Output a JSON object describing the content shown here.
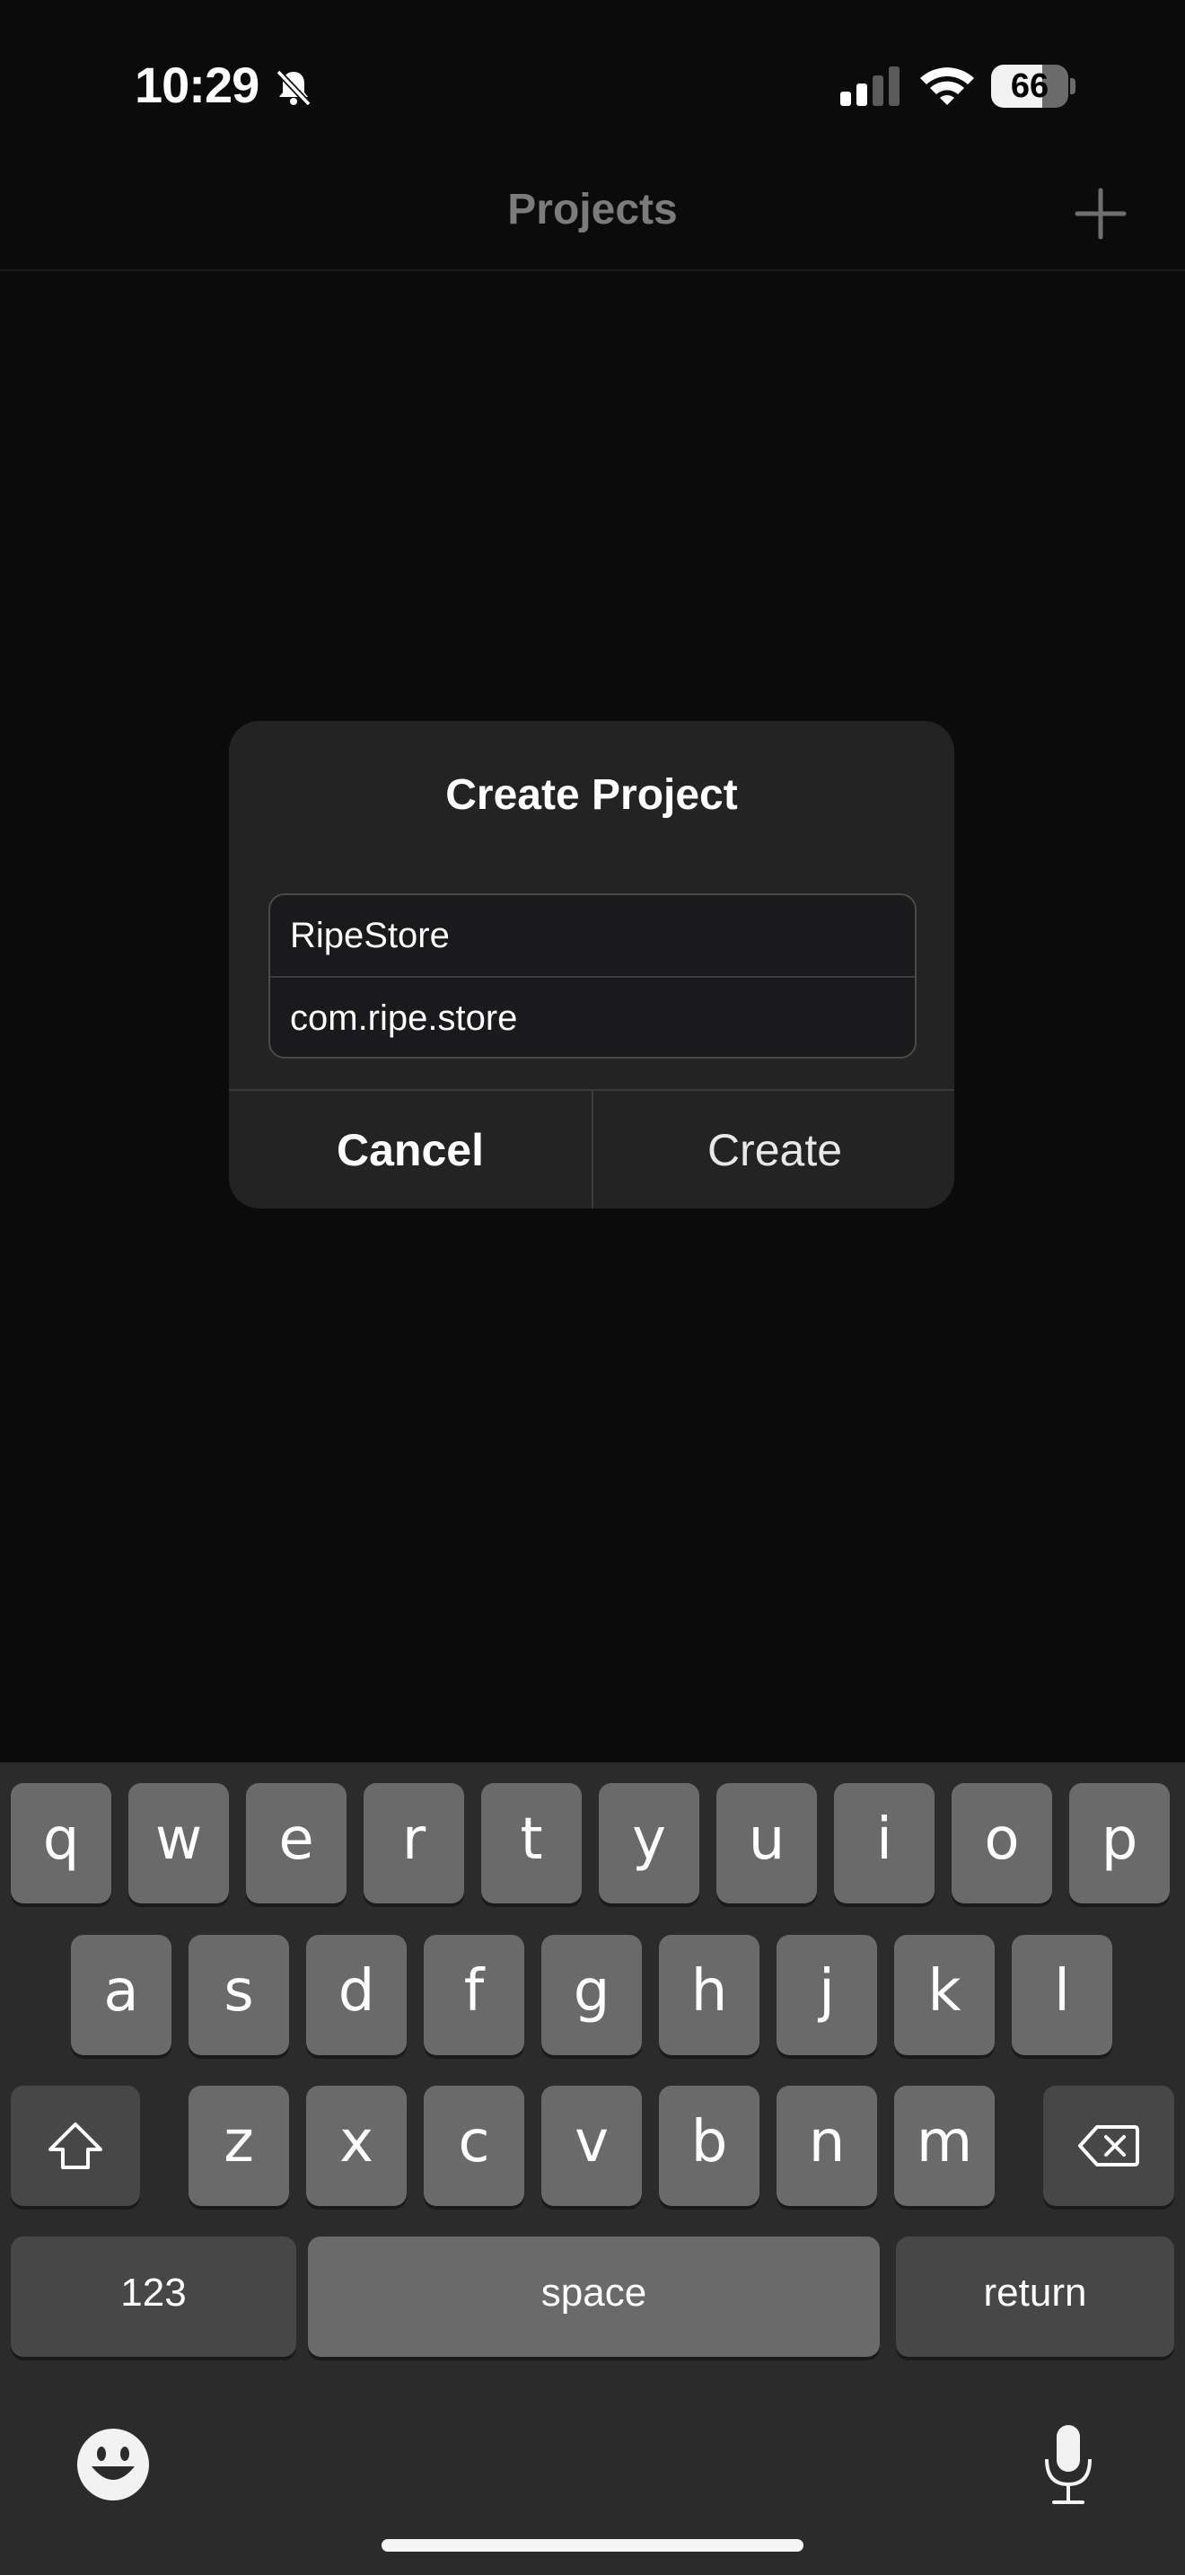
{
  "status": {
    "time": "10:29",
    "battery": "66",
    "battery_level_percent": 66,
    "icons": [
      "bell-slash-icon",
      "cellular-signal-icon",
      "wifi-icon",
      "battery-icon"
    ]
  },
  "nav": {
    "title": "Projects",
    "add_icon": "plus-icon"
  },
  "dialog": {
    "title": "Create Project",
    "name_value": "RipeStore",
    "bundle_value": "com.ripe.store",
    "cancel_label": "Cancel",
    "create_label": "Create"
  },
  "keyboard": {
    "row1": [
      "q",
      "w",
      "e",
      "r",
      "t",
      "y",
      "u",
      "i",
      "o",
      "p"
    ],
    "row2": [
      "a",
      "s",
      "d",
      "f",
      "g",
      "h",
      "j",
      "k",
      "l"
    ],
    "row3": [
      "z",
      "x",
      "c",
      "v",
      "b",
      "n",
      "m"
    ],
    "numbers_label": "123",
    "space_label": "space",
    "return_label": "return",
    "icons": [
      "shift-icon",
      "delete-icon",
      "emoji-icon",
      "microphone-icon"
    ]
  },
  "colors": {
    "background": "#0b0b0b",
    "dialog": "#232323",
    "key": "#6a6a6a",
    "key_dark": "#474747",
    "keyboard": "#2b2b2b"
  }
}
